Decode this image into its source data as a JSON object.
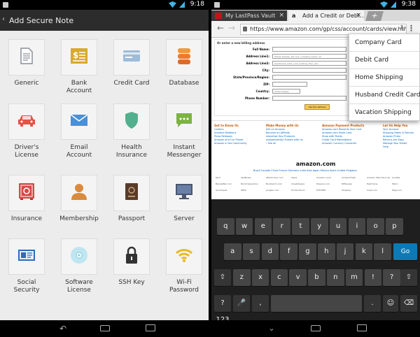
{
  "left": {
    "status_time": "9:18",
    "title": "Add Secure Note",
    "items": [
      {
        "label": "Generic",
        "icon": "document-icon"
      },
      {
        "label": "Bank\nAccount",
        "icon": "bank-icon"
      },
      {
        "label": "Credit Card",
        "icon": "credit-card-icon"
      },
      {
        "label": "Database",
        "icon": "database-icon"
      },
      {
        "label": "Driver's\nLicense",
        "icon": "car-icon"
      },
      {
        "label": "Email\nAccount",
        "icon": "envelope-icon"
      },
      {
        "label": "Health\nInsurance",
        "icon": "shield-icon"
      },
      {
        "label": "Instant\nMessenger",
        "icon": "chat-icon"
      },
      {
        "label": "Insurance",
        "icon": "safe-icon"
      },
      {
        "label": "Membership",
        "icon": "person-icon"
      },
      {
        "label": "Passport",
        "icon": "passport-icon"
      },
      {
        "label": "Server",
        "icon": "monitor-icon"
      },
      {
        "label": "Social\nSecurity",
        "icon": "id-card-icon"
      },
      {
        "label": "Software\nLicense",
        "icon": "disc-icon"
      },
      {
        "label": "SSH Key",
        "icon": "padlock-icon"
      },
      {
        "label": "Wi-Fi\nPassword",
        "icon": "wifi-icon"
      }
    ]
  },
  "right": {
    "status_time": "9:38",
    "tabs": [
      {
        "label": "My LastPass Vault",
        "close": "×"
      },
      {
        "label": "Add a Credit or Debi…",
        "close": "×",
        "favicon": "a"
      }
    ],
    "new_tab": "+",
    "url": "https://www.amazon.com/gp/css/account/cards/view.html/ref…",
    "dropdown": [
      "Company Card",
      "Debit Card",
      "Home Shipping",
      "Husband Credit Card",
      "Vacation Shipping"
    ],
    "page": {
      "form_title": "Or enter a new billing address",
      "fields": [
        {
          "label": "Full Name:",
          "value": ""
        },
        {
          "label": "Address Line1:",
          "value": "Street address, P.O. box, company name, c/o"
        },
        {
          "label": "Address Line2:",
          "value": "Apartment, suite, unit, building, floor, etc."
        },
        {
          "label": "City:",
          "value": ""
        },
        {
          "label": "State/Province/Region:",
          "value": ""
        },
        {
          "label": "ZIP:",
          "value": ""
        },
        {
          "label": "Country:",
          "value": "United States"
        },
        {
          "label": "Phone Number:",
          "value": ""
        }
      ],
      "form_button": "Use this address",
      "columns": [
        {
          "head": "Get to Know Us",
          "links": [
            "Careers",
            "Investor Relations",
            "Press Releases",
            "Amazon and Our Planet",
            "Amazon in the Community"
          ]
        },
        {
          "head": "Make Money with Us",
          "links": [
            "Sell on Amazon",
            "Become an Affiliate",
            "Advertise Your Products",
            "Independently Publish with Us",
            "› See all"
          ]
        },
        {
          "head": "Amazon Payment Products",
          "links": [
            "Amazon.com Rewards Visa Card",
            "Amazon.com Store Card",
            "Shop with Points",
            "Credit Card Marketplace",
            "Amazon Currency Converter"
          ]
        },
        {
          "head": "Let Us Help You",
          "links": [
            "Your Account",
            "Shipping Rates & Policies",
            "Amazon Prime",
            "Returns Are Easy",
            "Manage Your Kindle",
            "Help"
          ]
        }
      ],
      "logo": "amazon.com",
      "countries": "Brazil  Canada  China  France  Germany  India  Italy  Japan  Mexico  Spain  United Kingdom",
      "bottom_links": [
        "6pm",
        "AbeBooks",
        "AfterSchool.com",
        "Alexa",
        "Amazon Local",
        "AmazonFresh",
        "Amazon Web Services",
        "Audible",
        "BeautyBar.com",
        "Book Depository",
        "Bookworm.com",
        "CreateSpace",
        "Diapers.com",
        "DPReview",
        "East Dane",
        "Fabric",
        "Goodreads",
        "IMDb",
        "Junglee.com",
        "Kindle Direct",
        "MYHABIT",
        "Shopbop",
        "Soap.com",
        "Wag.com"
      ]
    },
    "keyboard": {
      "row1": [
        "q",
        "w",
        "e",
        "r",
        "t",
        "y",
        "u",
        "i",
        "o",
        "p"
      ],
      "row2": [
        "a",
        "s",
        "d",
        "f",
        "g",
        "h",
        "j",
        "k",
        "l"
      ],
      "row3": [
        "z",
        "x",
        "c",
        "v",
        "b",
        "n",
        "m",
        "!",
        "?"
      ],
      "go": "Go",
      "sym": "?123",
      "comma": ",",
      "dot": "."
    }
  },
  "colors": {
    "accent": "#3fb4e5",
    "go_key": "#0e7ab5",
    "amazon_orange": "#c45500",
    "link_blue": "#0066c0"
  }
}
